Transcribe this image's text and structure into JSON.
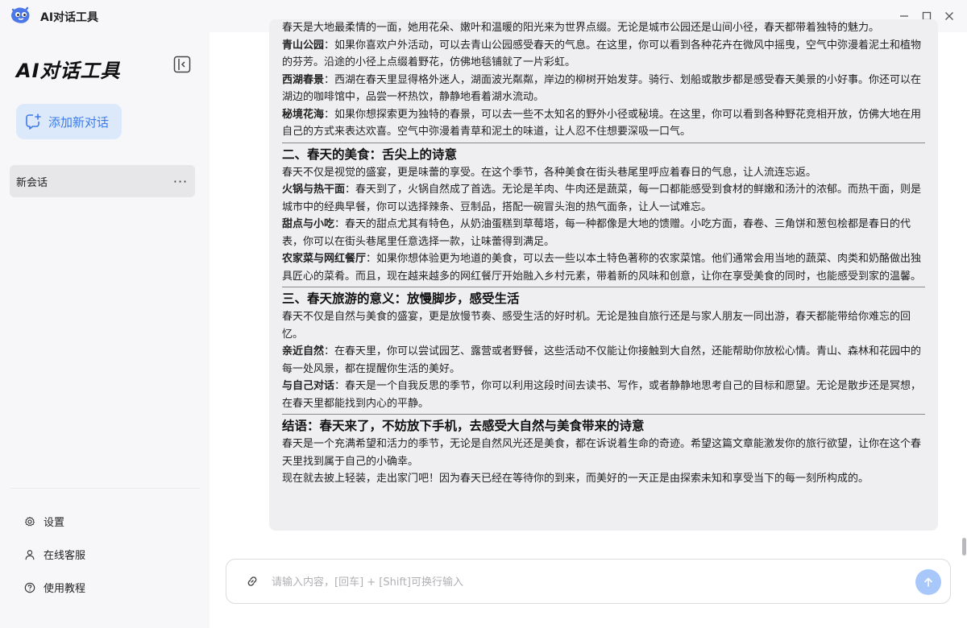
{
  "window": {
    "title": "AI对话工具"
  },
  "sidebar": {
    "title": "AI对话工具",
    "new_chat_label": "添加新对话",
    "chats": [
      {
        "label": "新会话",
        "more": "···"
      }
    ],
    "bottom": [
      {
        "label": "设置",
        "icon": "gear-icon"
      },
      {
        "label": "在线客服",
        "icon": "user-icon"
      },
      {
        "label": "使用教程",
        "icon": "help-icon"
      }
    ]
  },
  "message": {
    "intro": "春天是大地最柔情的一面，她用花朵、嫩叶和温暖的阳光来为世界点缀。无论是城市公园还是山间小径，春天都带着独特的魅力。",
    "s1_items": [
      {
        "title": "青山公园",
        "text": "：如果你喜欢户外活动，可以去青山公园感受春天的气息。在这里，你可以看到各种花卉在微风中摇曳，空气中弥漫着泥土和植物的芬芳。沿途的小径上点缀着野花，仿佛地毯铺就了一片彩虹。"
      },
      {
        "title": "西湖春景",
        "text": "：西湖在春天里显得格外迷人，湖面波光粼粼，岸边的柳树开始发芽。骑行、划船或散步都是感受春天美景的小好事。你还可以在湖边的咖啡馆中，品尝一杯热饮，静静地看着湖水流动。"
      },
      {
        "title": "秘境花海",
        "text": "：如果你想探索更为独特的春景，可以去一些不太知名的野外小径或秘境。在这里，你可以看到各种野花竞相开放，仿佛大地在用自己的方式来表达欢喜。空气中弥漫着青草和泥土的味道，让人忍不住想要深吸一口气。"
      }
    ],
    "s2_head": "二、春天的美食：舌尖上的诗意",
    "s2_intro": "春天不仅是视觉的盛宴，更是味蕾的享受。在这个季节，各种美食在街头巷尾里呼应着春日的气息，让人流连忘返。",
    "s2_items": [
      {
        "title": "火锅与热干面",
        "text": "：春天到了，火锅自然成了首选。无论是羊肉、牛肉还是蔬菜，每一口都能感受到食材的鲜嫩和汤汁的浓郁。而热干面，则是城市中的经典早餐，你可以选择辣条、豆制品，搭配一碗冒头泡的热气面条，让人一试难忘。"
      },
      {
        "title": "甜点与小吃",
        "text": "：春天的甜点尤其有特色，从奶油蛋糕到草莓塔，每一种都像是大地的馈赠。小吃方面，春卷、三角饼和葱包桧都是春日的代表，你可以在街头巷尾里任意选择一款，让味蕾得到满足。"
      },
      {
        "title": "农家菜与网红餐厅",
        "text": "：如果你想体验更为地道的美食，可以去一些以本土特色著称的农家菜馆。他们通常会用当地的蔬菜、肉类和奶酪做出独具匠心的菜肴。而且，现在越来越多的网红餐厅开始融入乡村元素，带着新的风味和创意，让你在享受美食的同时，也能感受到家的温馨。"
      }
    ],
    "s3_head": "三、春天旅游的意义：放慢脚步，感受生活",
    "s3_intro": "春天不仅是自然与美食的盛宴，更是放慢节奏、感受生活的好时机。无论是独自旅行还是与家人朋友一同出游，春天都能带给你难忘的回忆。",
    "s3_items": [
      {
        "title": "亲近自然",
        "text": "：在春天里，你可以尝试园艺、露营或者野餐，这些活动不仅能让你接触到大自然，还能帮助你放松心情。青山、森林和花园中的每一处风景，都在提醒你生活的美好。"
      },
      {
        "title": "与自己对话",
        "text": "：春天是一个自我反思的季节，你可以利用这段时间去读书、写作，或者静静地思考自己的目标和愿望。无论是散步还是冥想，在春天里都能找到内心的平静。"
      }
    ],
    "s4_head": "结语：春天来了，不妨放下手机，去感受大自然与美食带来的诗意",
    "s4_p1": "春天是一个充满希望和活力的季节，无论是自然风光还是美食，都在诉说着生命的奇迹。希望这篇文章能激发你的旅行欲望，让你在这个春天里找到属于自己的小确幸。",
    "s4_p2": "现在就去披上轻装，走出家门吧！因为春天已经在等待你的到来，而美好的一天正是由探索未知和享受当下的每一刻所构成的。"
  },
  "input": {
    "value": "",
    "placeholder": "请输入内容，[回车] + [Shift]可换行输入"
  },
  "colors": {
    "accent": "#3f7be6",
    "accent_light": "#dce9fb",
    "send": "#a8c8fb",
    "sidebar_bg": "#f7f7f9",
    "bubble_bg": "#efeff1"
  }
}
